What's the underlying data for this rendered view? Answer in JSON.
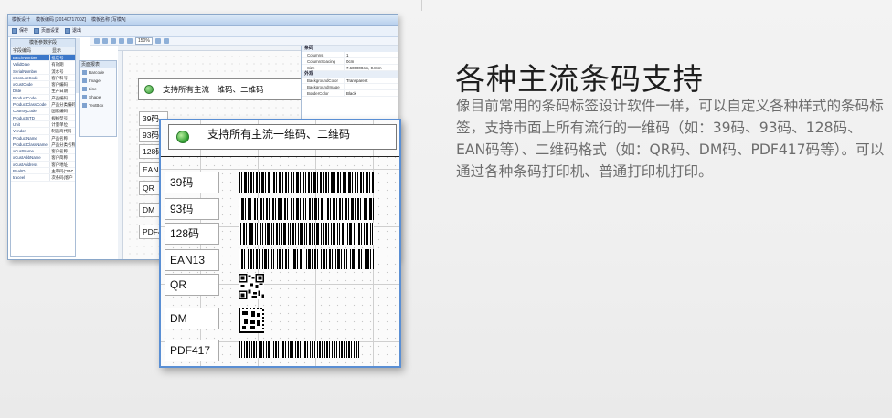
{
  "app": {
    "title_items": [
      "模板设计",
      "模板编码 [2014071700Z]",
      "模板名称 [写模A]"
    ],
    "toolbar": [
      "保存",
      "页面设置",
      "退出"
    ],
    "zoom": "150%",
    "left_panel_title": "模板参数字段",
    "left_panel_headers": [
      "字段编码",
      "显示"
    ],
    "fields": [
      {
        "code": "BatchNumber",
        "name": "批次号"
      },
      {
        "code": "ValidDate",
        "name": "有效期"
      },
      {
        "code": "SerialNumber",
        "name": "流水号"
      },
      {
        "code": "xConLocCode",
        "name": "客户料号"
      },
      {
        "code": "xCustCode",
        "name": "客户编码"
      },
      {
        "code": "Date",
        "name": "生产日期"
      },
      {
        "code": "ProductCode",
        "name": "产品编码"
      },
      {
        "code": "ProductClassCode",
        "name": "产品分类编码"
      },
      {
        "code": "CountryCode",
        "name": "国家编码"
      },
      {
        "code": "ProductSTD",
        "name": "规格型号"
      },
      {
        "code": "Unit",
        "name": "计量单位"
      },
      {
        "code": "Vendor",
        "name": "制造商代码"
      },
      {
        "code": "ProductName",
        "name": "产品名称"
      },
      {
        "code": "ProductClassName",
        "name": "产品分类名称"
      },
      {
        "code": "xCustName",
        "name": "客户名称"
      },
      {
        "code": "xCustAbbName",
        "name": "客户简称"
      },
      {
        "code": "xCustAddress",
        "name": "客户地址"
      },
      {
        "code": "RealID",
        "name": "主审码(\"SN\""
      },
      {
        "code": "traceel",
        "name": "次条码(客户"
      }
    ],
    "toolbox_title": "页面报表",
    "toolbox_items": [
      "Barcode",
      "Image",
      "Line",
      "Shape",
      "TextBox"
    ],
    "canvas_header": "支持所有主流一维码、二维码",
    "canvas_labels": [
      "39码",
      "93码",
      "128码",
      "EAN13",
      "QR",
      "DM",
      "PDF417"
    ],
    "properties": [
      {
        "cat": "条码"
      },
      {
        "key": "Columns",
        "val": "1"
      },
      {
        "key": "ColumnSpacing",
        "val": "0cm"
      },
      {
        "key": "Size",
        "val": "7.600000cm, 0.8cm"
      },
      {
        "cat": "外观"
      },
      {
        "key": "BackgroundColor",
        "val": "Transparent"
      },
      {
        "key": "BackgroundImage",
        "val": ""
      },
      {
        "key": "BorderColor",
        "val": "Black"
      }
    ]
  },
  "front": {
    "header": "支持所有主流一维码、二维码",
    "rows": [
      "39码",
      "93码",
      "128码",
      "EAN13",
      "QR",
      "DM",
      "PDF417"
    ]
  },
  "headline": "各种主流条码支持",
  "description": "像目前常用的条码标签设计软件一样，可以自定义各种样式的条码标签，支持市面上所有流行的一维码（如：39码、93码、128码、EAN码等）、二维码格式（如：QR码、DM码、PDF417码等）。可以通过各种条码打印机、普通打印机打印。",
  "colors": {
    "accent": "#5a8fd4",
    "headline": "#1e1e1e",
    "body_text": "#6d6d6d",
    "status_green": "#2e9d30"
  }
}
